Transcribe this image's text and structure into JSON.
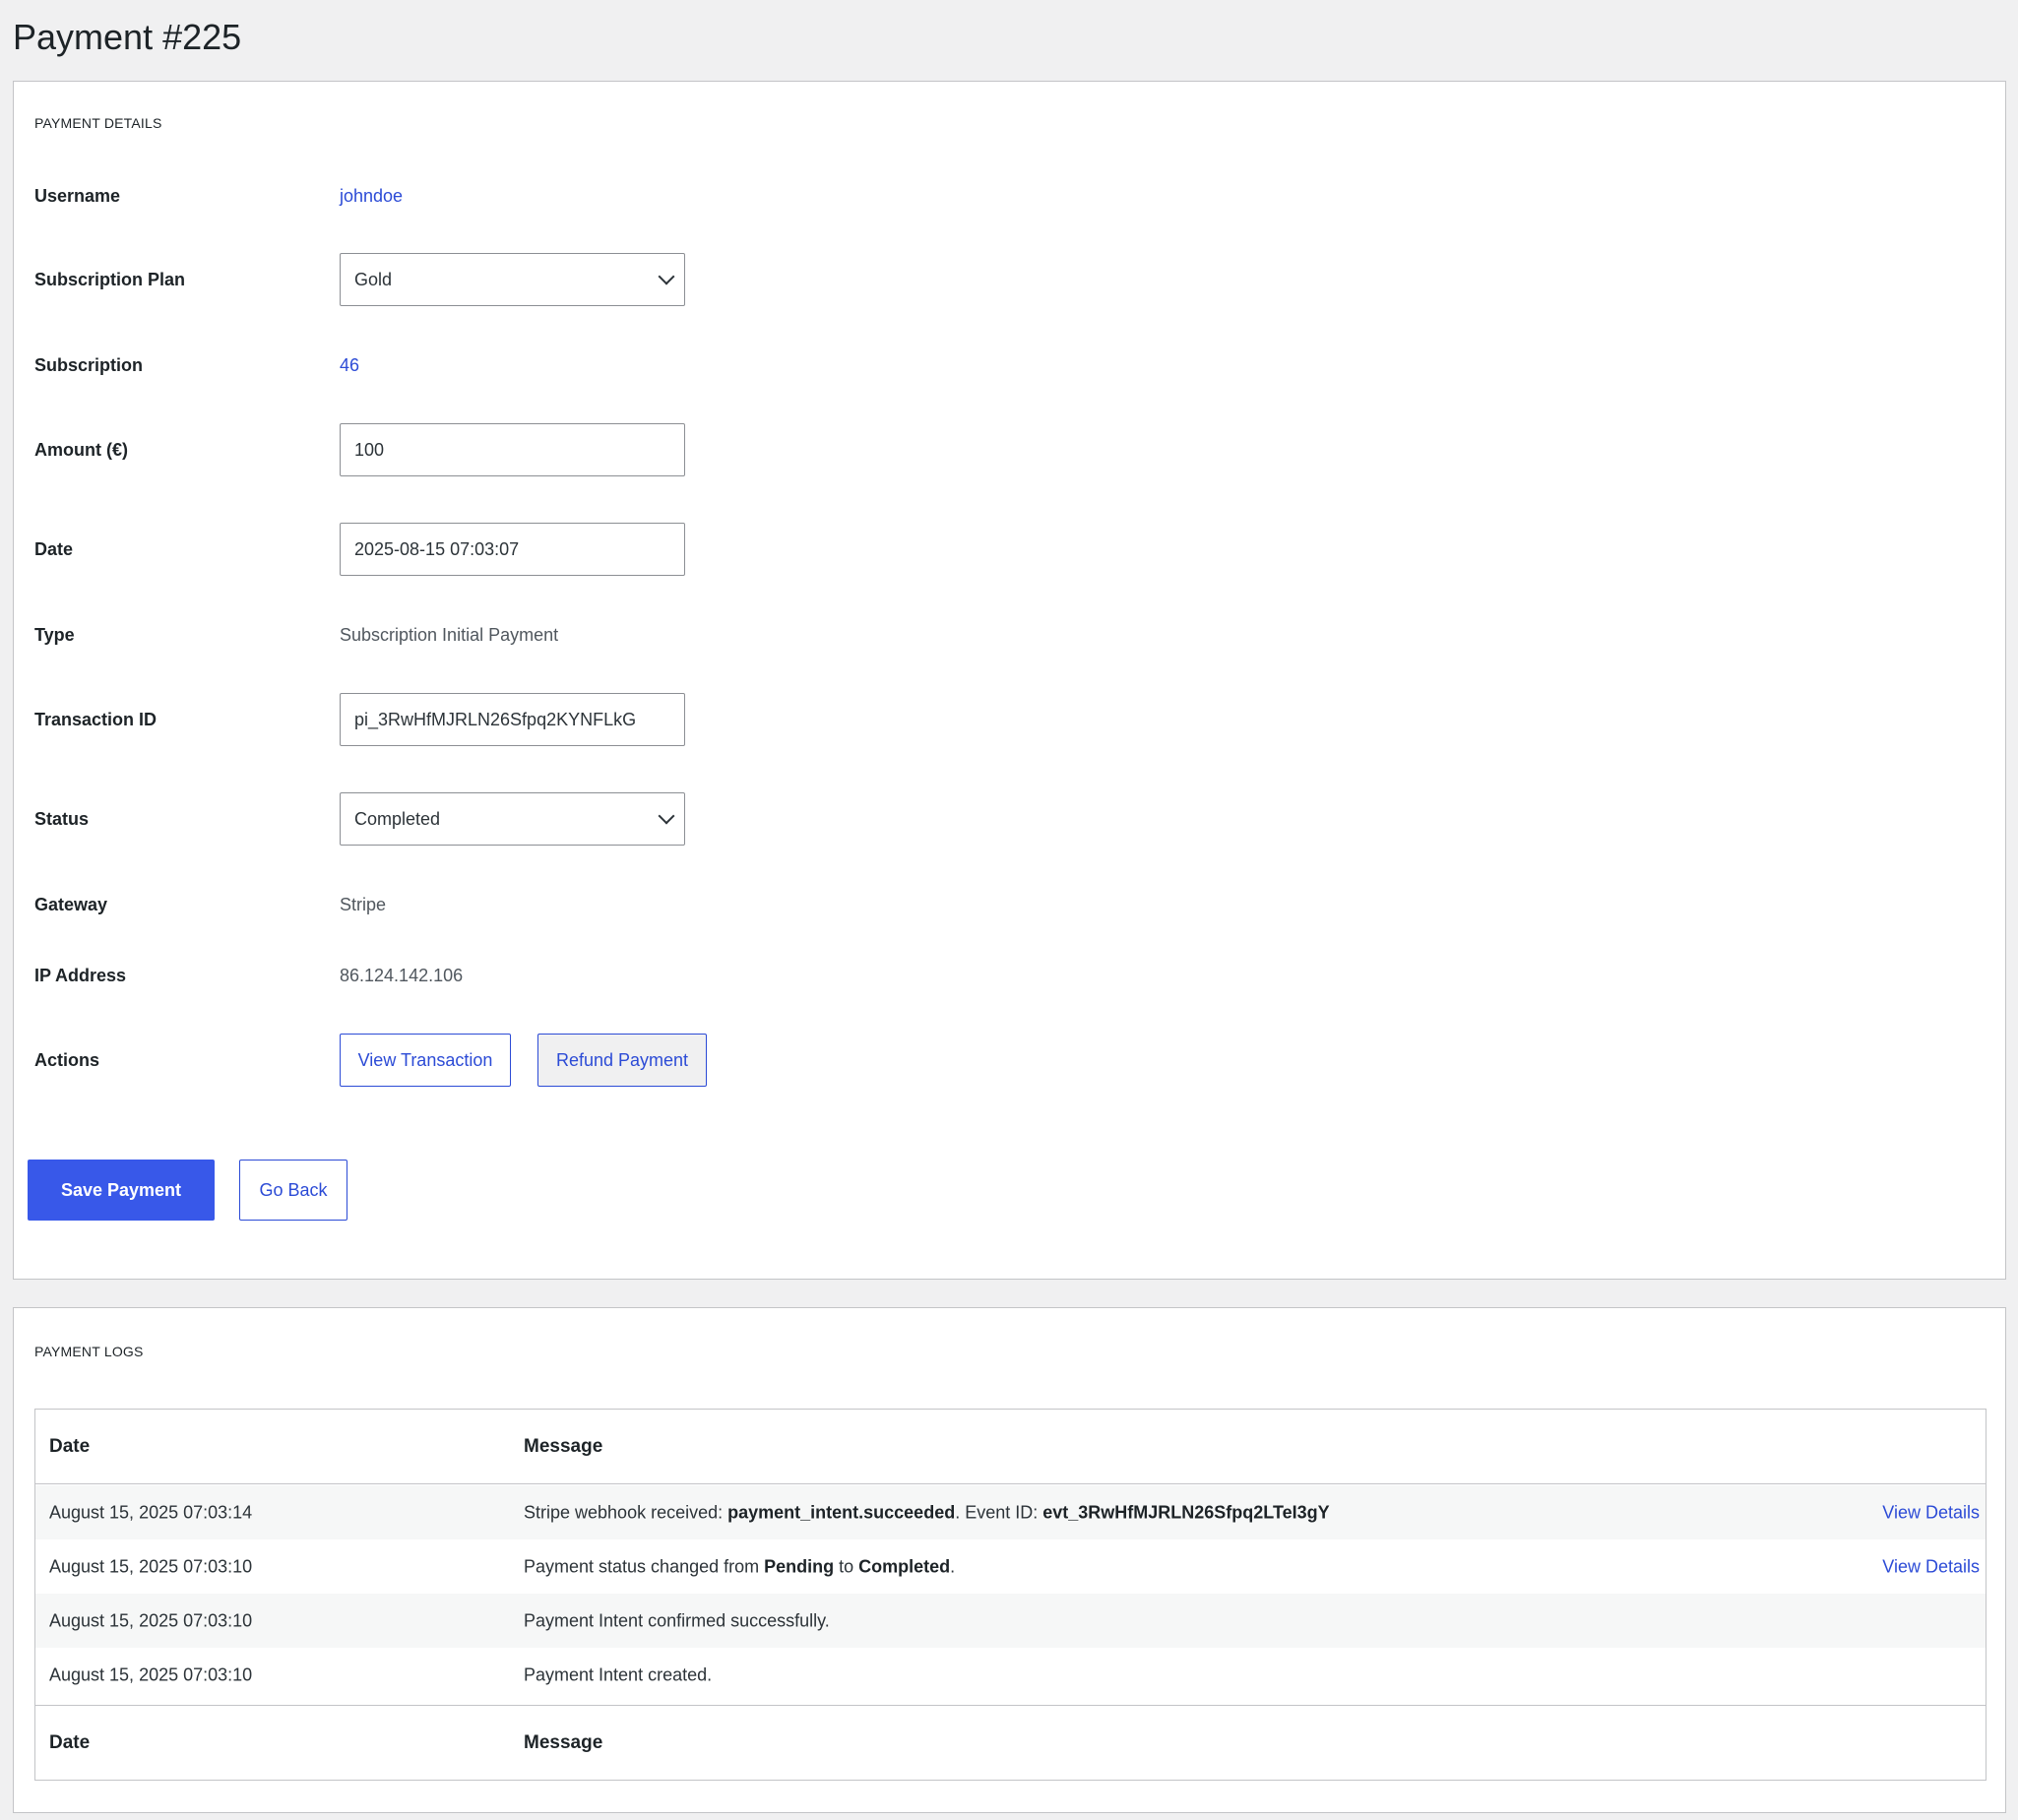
{
  "page": {
    "title": "Payment #225"
  },
  "details": {
    "heading": "PAYMENT DETAILS",
    "username": {
      "label": "Username",
      "value": "johndoe"
    },
    "plan": {
      "label": "Subscription Plan",
      "value": "Gold"
    },
    "subscription": {
      "label": "Subscription",
      "value": "46"
    },
    "amount": {
      "label": "Amount (€)",
      "value": "100"
    },
    "date": {
      "label": "Date",
      "value": "2025-08-15 07:03:07"
    },
    "type": {
      "label": "Type",
      "value": "Subscription Initial Payment"
    },
    "transaction": {
      "label": "Transaction ID",
      "value": "pi_3RwHfMJRLN26Sfpq2KYNFLkG"
    },
    "status": {
      "label": "Status",
      "value": "Completed"
    },
    "gateway": {
      "label": "Gateway",
      "value": "Stripe"
    },
    "ip": {
      "label": "IP Address",
      "value": "86.124.142.106"
    },
    "actions": {
      "label": "Actions",
      "view_transaction": "View Transaction",
      "refund": "Refund Payment"
    },
    "save_label": "Save Payment",
    "back_label": "Go Back"
  },
  "logs": {
    "heading": "PAYMENT LOGS",
    "col_date": "Date",
    "col_message": "Message",
    "view_details": "View Details",
    "rows": [
      {
        "date": "August 15, 2025 07:03:14",
        "pre": "Stripe webhook received: ",
        "b1": "payment_intent.succeeded",
        "mid": ". Event ID: ",
        "b2": "evt_3RwHfMJRLN26Sfpq2LTeI3gY",
        "post": ""
      },
      {
        "date": "August 15, 2025 07:03:10",
        "pre": "Payment status changed from ",
        "b1": "Pending",
        "mid": " to ",
        "b2": "Completed",
        "post": "."
      },
      {
        "date": "August 15, 2025 07:03:10",
        "message": "Payment Intent confirmed successfully."
      },
      {
        "date": "August 15, 2025 07:03:10",
        "message": "Payment Intent created."
      }
    ]
  },
  "colors": {
    "accent": "#3858e9",
    "link": "#2c4bd6",
    "background": "#f0f0f1",
    "panel": "#ffffff",
    "border": "#c3c4c7"
  }
}
